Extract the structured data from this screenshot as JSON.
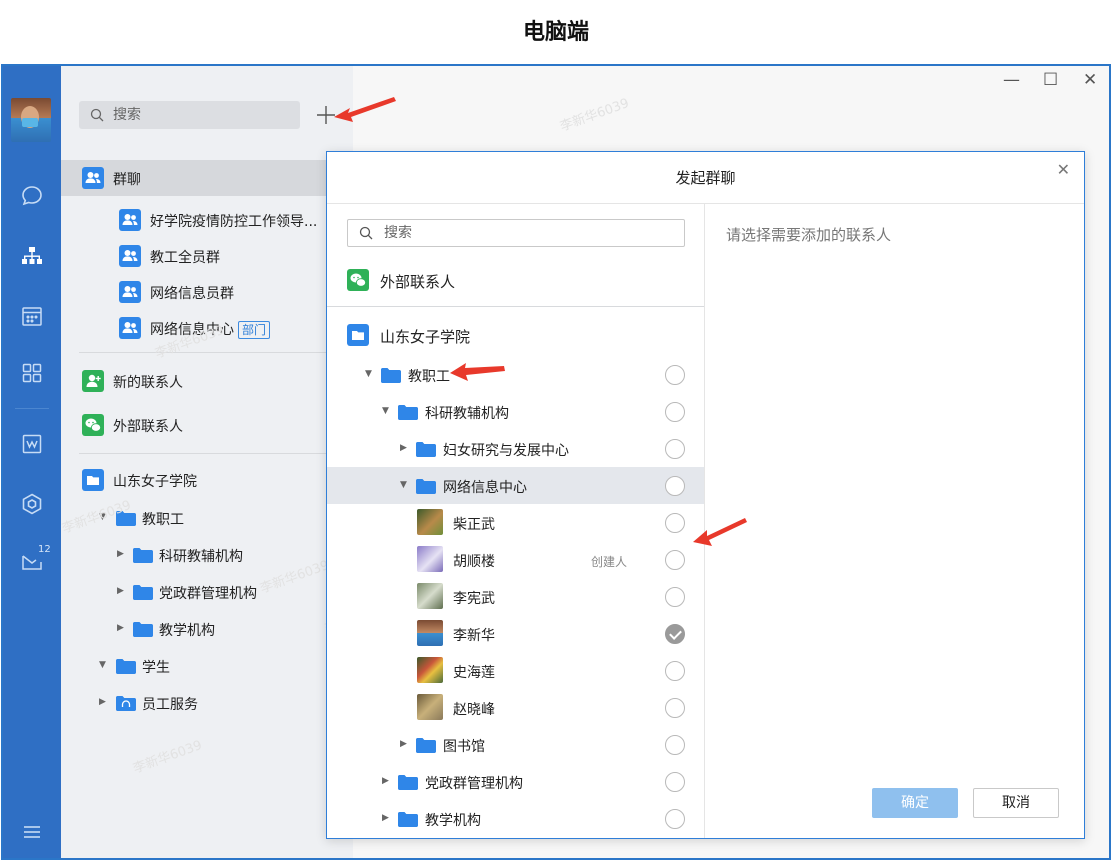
{
  "caption": "电脑端",
  "window": {
    "controls": {
      "minimize": "—",
      "maximize": "☐",
      "close": "✕"
    }
  },
  "rail": {
    "mail_badge": "12"
  },
  "panel": {
    "search_placeholder": "搜索",
    "group_chat": {
      "label": "群聊",
      "items": [
        {
          "label": "好学院疫情防控工作领导..."
        },
        {
          "label": "教工全员群"
        },
        {
          "label": "网络信息员群"
        },
        {
          "label": "网络信息中心",
          "tag": "部门"
        }
      ]
    },
    "new_contacts": "新的联系人",
    "external_contacts": "外部联系人",
    "org": {
      "name": "山东女子学院",
      "tree": [
        {
          "label": "教职工"
        },
        {
          "label": "科研教辅机构"
        },
        {
          "label": "党政群管理机构"
        },
        {
          "label": "教学机构"
        },
        {
          "label": "学生"
        },
        {
          "label": "员工服务"
        }
      ]
    }
  },
  "dialog": {
    "title": "发起群聊",
    "close": "✕",
    "search_placeholder": "搜索",
    "external_contacts": "外部联系人",
    "org_name": "山东女子学院",
    "tree": [
      {
        "label": "教职工"
      },
      {
        "label": "科研教辅机构"
      },
      {
        "label": "妇女研究与发展中心"
      },
      {
        "label": "网络信息中心"
      },
      {
        "label": "柴正武"
      },
      {
        "label": "胡顺楼",
        "note": "创建人"
      },
      {
        "label": "李宪武"
      },
      {
        "label": "李新华",
        "checked": true
      },
      {
        "label": "史海莲"
      },
      {
        "label": "赵晓峰"
      },
      {
        "label": "图书馆"
      },
      {
        "label": "党政群管理机构"
      },
      {
        "label": "教学机构"
      }
    ],
    "hint": "请选择需要添加的联系人",
    "confirm_label": "确定",
    "cancel_label": "取消"
  },
  "watermark": "李新华6039",
  "colors": {
    "brand_blue": "#2f6fc4",
    "icon_blue": "#2f86e8",
    "icon_green": "#2fb158",
    "annotation_red": "#e8392b"
  }
}
